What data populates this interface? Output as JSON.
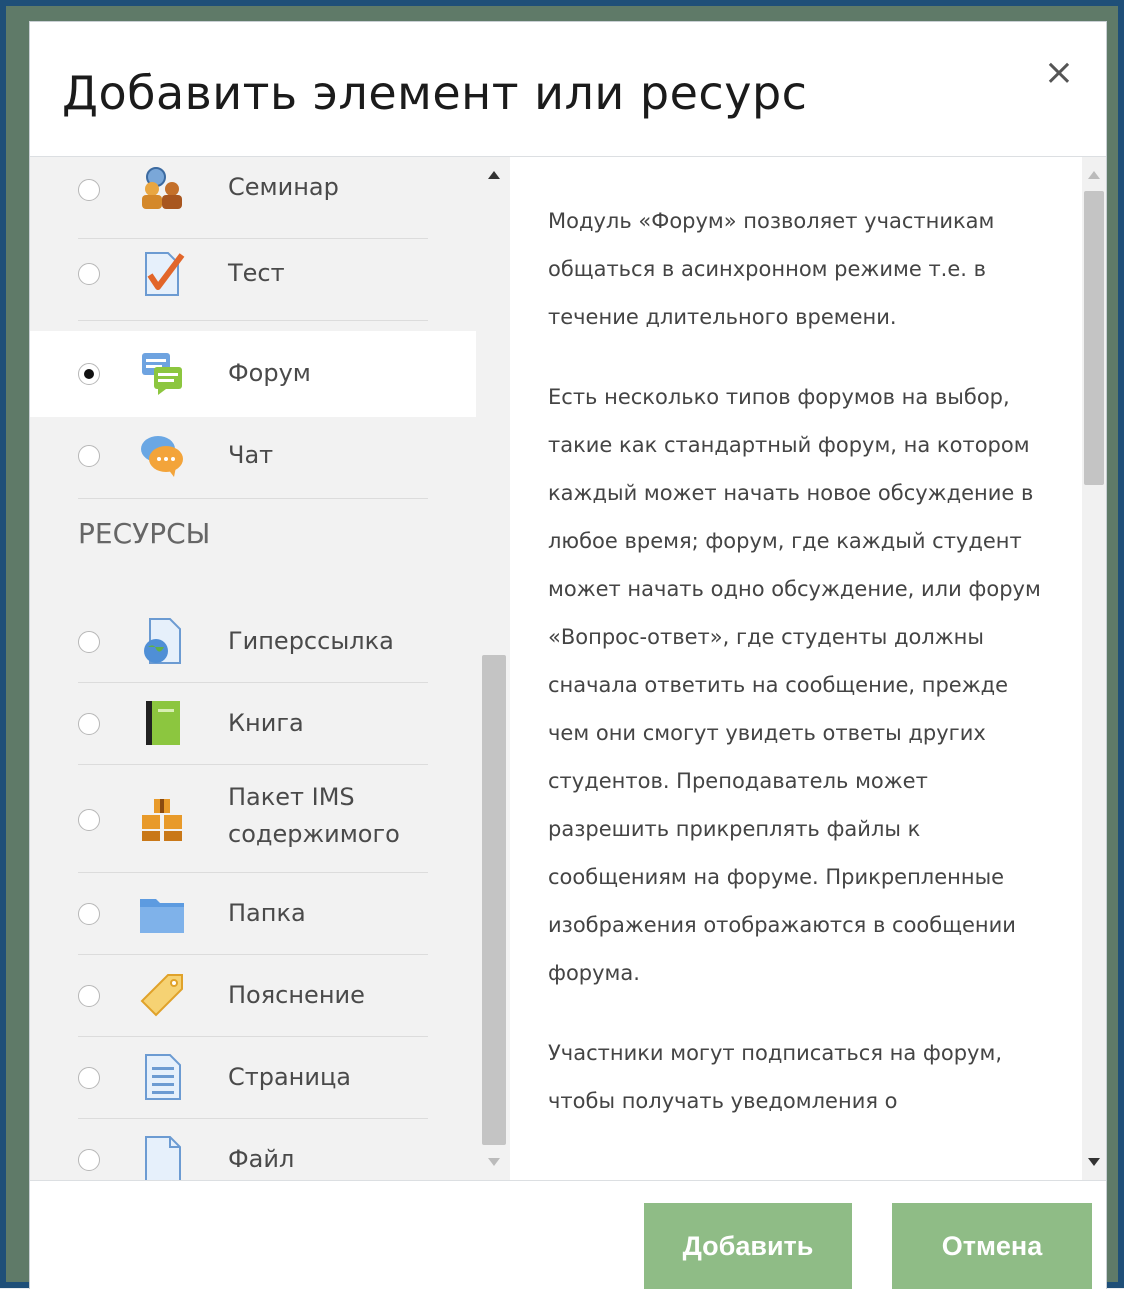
{
  "modal": {
    "title": "Добавить элемент или ресурс",
    "close_label": "×"
  },
  "activities": [
    {
      "label": "Семинар",
      "icon": "workshop-icon",
      "selected": false
    },
    {
      "label": "Тест",
      "icon": "quiz-icon",
      "selected": false
    },
    {
      "label": "Форум",
      "icon": "forum-icon",
      "selected": true
    },
    {
      "label": "Чат",
      "icon": "chat-icon",
      "selected": false
    }
  ],
  "resources_heading": "РЕСУРСЫ",
  "resources": [
    {
      "label": "Гиперссылка",
      "icon": "url-icon"
    },
    {
      "label": "Книга",
      "icon": "book-icon"
    },
    {
      "label_line1": "Пакет IMS",
      "label_line2": "содержимого",
      "icon": "ims-package-icon"
    },
    {
      "label": "Папка",
      "icon": "folder-icon"
    },
    {
      "label": "Пояснение",
      "icon": "label-icon"
    },
    {
      "label": "Страница",
      "icon": "page-icon"
    },
    {
      "label": "Файл",
      "icon": "file-icon"
    }
  ],
  "description": {
    "p1": "Модуль «Форум» позволяет участникам общаться в асинхронном режиме т.е. в течение длительного времени.",
    "p2": "Есть несколько типов форумов на выбор, такие как стандартный форум, на котором каждый может начать новое обсуждение в любое время; форум, где каждый студент может начать одно обсуждение, или форум «Вопрос-ответ», где студенты должны сначала ответить на сообщение, прежде чем они смогут увидеть ответы других студентов. Преподаватель может разрешить прикреплять файлы к сообщениям на форуме. Прикрепленные изображения отображаются в сообщении форума.",
    "p3": "Участники могут подписаться на форум, чтобы получать уведомления о"
  },
  "footer": {
    "add_label": "Добавить",
    "cancel_label": "Отмена"
  },
  "colors": {
    "button": "#8fbc86",
    "frame": "#1f4f78"
  }
}
